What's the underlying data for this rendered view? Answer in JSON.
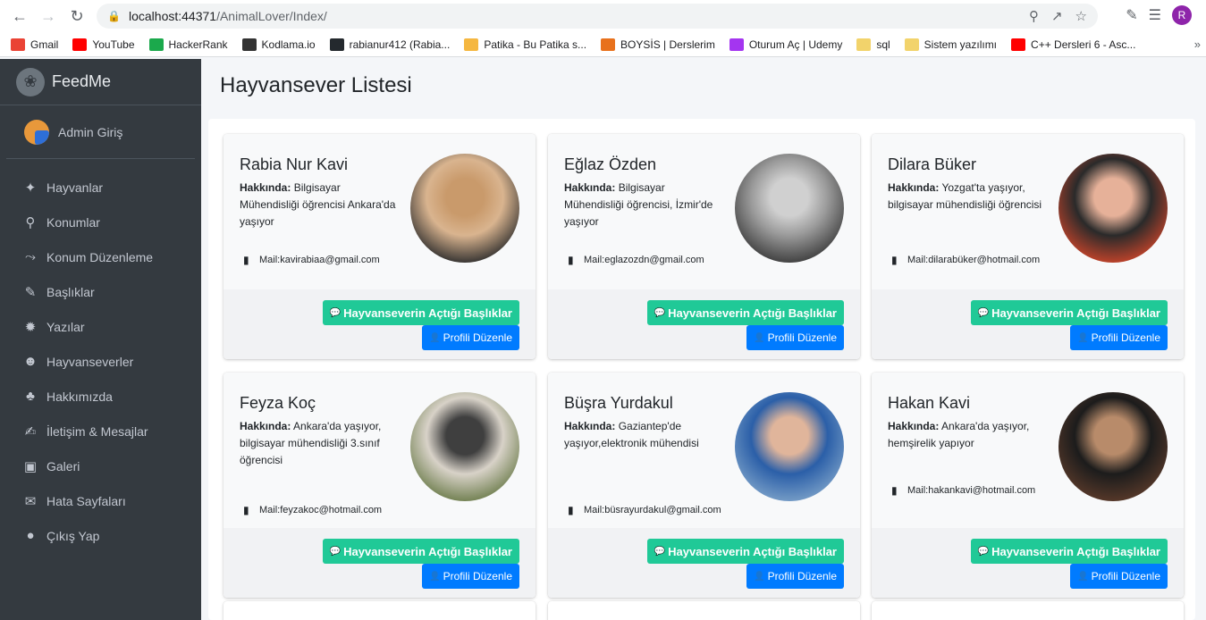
{
  "browser": {
    "url_host": "localhost:44371",
    "url_path": "/AnimalLover/Index/",
    "profile_initial": "R",
    "bookmarks": [
      {
        "label": "Gmail",
        "icon": "gmail-icon",
        "color": "#ea4335"
      },
      {
        "label": "YouTube",
        "icon": "youtube-icon",
        "color": "#ff0000"
      },
      {
        "label": "HackerRank",
        "icon": "hackerrank-icon",
        "color": "#1ba94c"
      },
      {
        "label": "Kodlama.io",
        "icon": "kodlama-icon",
        "color": "#333333"
      },
      {
        "label": "rabianur412 (Rabia...",
        "icon": "github-icon",
        "color": "#24292e"
      },
      {
        "label": "Patika - Bu Patika s...",
        "icon": "patika-icon",
        "color": "#f5b740"
      },
      {
        "label": "BOYSİS | Derslerim",
        "icon": "boysis-icon",
        "color": "#e8711c"
      },
      {
        "label": "Oturum Aç | Udemy",
        "icon": "udemy-icon",
        "color": "#a435f0"
      },
      {
        "label": "sql",
        "icon": "folder-icon",
        "color": "#f2d36b"
      },
      {
        "label": "Sistem yazılımı",
        "icon": "folder-icon",
        "color": "#f2d36b"
      },
      {
        "label": "C++ Dersleri 6 - Asc...",
        "icon": "youtube-icon",
        "color": "#ff0000"
      }
    ]
  },
  "sidebar": {
    "brand": "FeedMe",
    "user": "Admin Giriş",
    "items": [
      {
        "label": "Hayvanlar",
        "icon": "paw-icon"
      },
      {
        "label": "Konumlar",
        "icon": "map-marker-icon"
      },
      {
        "label": "Konum Düzenleme",
        "icon": "route-icon"
      },
      {
        "label": "Başlıklar",
        "icon": "feather-icon"
      },
      {
        "label": "Yazılar",
        "icon": "cog-icon"
      },
      {
        "label": "Hayvanseverler",
        "icon": "users-icon"
      },
      {
        "label": "Hakkımızda",
        "icon": "tree-icon"
      },
      {
        "label": "İletişim & Mesajlar",
        "icon": "edit-icon"
      },
      {
        "label": "Galeri",
        "icon": "image-icon"
      },
      {
        "label": "Hata Sayfaları",
        "icon": "envelope-icon"
      },
      {
        "label": "Çıkış Yap",
        "icon": "apple-icon"
      }
    ]
  },
  "page": {
    "title": "Hayvansever Listesi",
    "about_label": "Hakkında:",
    "topics_button": "Hayvanseverin Açtığı Başlıklar",
    "edit_button": "Profili Düzenle"
  },
  "cards": [
    {
      "name": "Rabia Nur Kavi",
      "about": "Bilgisayar Mühendisliği öğrencisi Ankara'da yaşıyor",
      "mail": "Mail:kavirabiaa@gmail.com",
      "avatar_colors": [
        "#2b2b2b",
        "#d9b48f",
        "#c99a6b"
      ]
    },
    {
      "name": "Eğlaz Özden",
      "about": "Bilgisayar Mühendisliği öğrencisi, İzmir'de yaşıyor",
      "mail": "Mail:eglazozdn@gmail.com",
      "avatar_colors": [
        "#3a3a3a",
        "#9a9a9a",
        "#d0d0d0"
      ]
    },
    {
      "name": "Dilara Büker",
      "about": "Yozgat'ta yaşıyor, bilgisayar mühendisliği öğrencisi",
      "mail": "Mail:dilarabüker@hotmail.com",
      "avatar_colors": [
        "#c8442a",
        "#2a2a2a",
        "#e6b199"
      ]
    },
    {
      "name": "Feyza Koç",
      "about": "Ankara'da yaşıyor, bilgisayar mühendisliği 3.sınıf öğrencisi",
      "mail": "Mail:feyzakoc@hotmail.com",
      "avatar_colors": [
        "#6b7b4a",
        "#d8d2c8",
        "#3f3f3f"
      ]
    },
    {
      "name": "Büşra Yurdakul",
      "about": "Gaziantep'de yaşıyor,elektronik mühendisi",
      "mail": "Mail:büsrayurdakul@gmail.com",
      "avatar_colors": [
        "#7aa0c8",
        "#2b5fa8",
        "#e0b59b"
      ]
    },
    {
      "name": "Hakan Kavi",
      "about": "Ankara'da yaşıyor, hemşirelik yapıyor",
      "mail": "Mail:hakankavi@hotmail.com",
      "avatar_colors": [
        "#5a3a2a",
        "#1c1c1c",
        "#b88b6a"
      ]
    }
  ]
}
